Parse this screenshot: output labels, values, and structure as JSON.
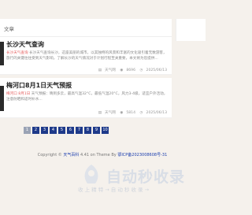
{
  "section": {
    "title": "文章"
  },
  "articles": [
    {
      "title": "长沙天气查询",
      "excerpt_link": "长沙天气查询",
      "excerpt": "长沙天气查询长沙，这座美丽的城市，以其独特的风景和丰富的文化吸引着无数游客，旅行的关键往往受到天气影响，了解长沙的天气情况对于计划行程至关重要，本文将为您提供...",
      "category": "天气网",
      "views": "8696",
      "date": "2025/06/13"
    },
    {
      "title": "梅河口8月1日天气预报",
      "excerpt_link1": "梅河口",
      "excerpt_link2": "8月1日",
      "excerpt": "天气预报：晴到多云，最高气温32°C，最低气温20°C，风力3-4级，适宜户外活动，注意防晒和适时补水...",
      "category": "天气网",
      "views": "5814",
      "date": "2025/06/13"
    }
  ],
  "pagination": [
    "1",
    "2",
    "3",
    "4",
    "5",
    "6",
    "7",
    "8",
    "9",
    "10"
  ],
  "footer": {
    "copyright": "Copyright ©",
    "site": "天气百科",
    "theme": "4.41 on Theme By",
    "icp": "鄂ICP备2023008608号-31"
  },
  "watermark": {
    "main": "自动秒收录",
    "sub": "收 上 精 特 → 自 动 秒 收 录 →"
  }
}
